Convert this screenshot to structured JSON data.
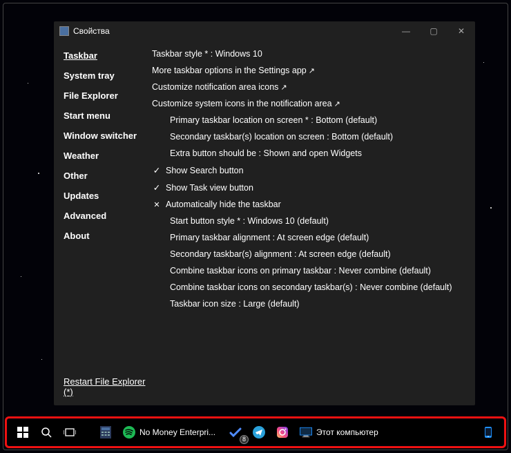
{
  "window": {
    "title": "Свойства",
    "btn_min": "—",
    "btn_max": "▢",
    "btn_close": "✕"
  },
  "sidebar": {
    "items": [
      {
        "label": "Taskbar",
        "active": true
      },
      {
        "label": "System tray"
      },
      {
        "label": "File Explorer"
      },
      {
        "label": "Start menu"
      },
      {
        "label": "Window switcher"
      },
      {
        "label": "Weather"
      },
      {
        "label": "Other"
      },
      {
        "label": "Updates"
      },
      {
        "label": "Advanced"
      },
      {
        "label": "About"
      }
    ],
    "restart": "Restart File Explorer (*)"
  },
  "content": {
    "r0": "Taskbar style * : Windows 10",
    "r1": "More taskbar options in the Settings app",
    "r2": "Customize notification area icons",
    "r3": "Customize system icons in the notification area",
    "r4": "Primary taskbar location on screen * : Bottom (default)",
    "r5": "Secondary taskbar(s) location on screen : Bottom (default)",
    "r6": "Extra button should be : Shown and open Widgets",
    "r7": "Show Search button",
    "r8": "Show Task view button",
    "r9": "Automatically hide the taskbar",
    "r10": "Start button style * : Windows 10 (default)",
    "r11": "Primary taskbar alignment : At screen edge (default)",
    "r12": "Secondary taskbar(s) alignment : At screen edge (default)",
    "r13": "Combine taskbar icons on primary taskbar : Never combine (default)",
    "r14": "Combine taskbar icons on secondary taskbar(s) : Never combine (default)",
    "r15": "Taskbar icon size : Large (default)"
  },
  "taskbar": {
    "spotify": "No Money Enterpri...",
    "todo_badge": "8",
    "explorer": "Этот компьютер"
  }
}
